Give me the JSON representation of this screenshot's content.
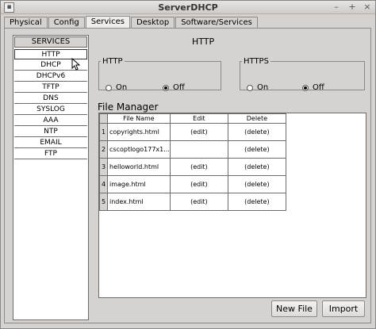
{
  "window": {
    "title": "ServerDHCP",
    "minimize_glyph": "–",
    "maximize_glyph": "+",
    "close_glyph": "×"
  },
  "tabs": [
    "Physical",
    "Config",
    "Services",
    "Desktop",
    "Software/Services"
  ],
  "active_tab": "Services",
  "sidebar": {
    "header": "SERVICES",
    "items": [
      "HTTP",
      "DHCP",
      "DHCPv6",
      "TFTP",
      "DNS",
      "SYSLOG",
      "AAA",
      "NTP",
      "EMAIL",
      "FTP"
    ],
    "selected": "HTTP"
  },
  "main": {
    "title": "HTTP",
    "http_group": {
      "legend": "HTTP",
      "on_label": "On",
      "off_label": "Off",
      "value": "Off"
    },
    "https_group": {
      "legend": "HTTPS",
      "on_label": "On",
      "off_label": "Off",
      "value": "Off"
    },
    "file_manager": {
      "label": "File Manager",
      "columns": [
        "File Name",
        "Edit",
        "Delete"
      ],
      "rows": [
        {
          "num": "1",
          "file": "copyrights.html",
          "edit": "(edit)",
          "delete": "(delete)"
        },
        {
          "num": "2",
          "file": "cscoptlogo177x1...",
          "edit": "",
          "delete": "(delete)"
        },
        {
          "num": "3",
          "file": "helloworld.html",
          "edit": "(edit)",
          "delete": "(delete)"
        },
        {
          "num": "4",
          "file": "image.html",
          "edit": "(edit)",
          "delete": "(delete)"
        },
        {
          "num": "5",
          "file": "index.html",
          "edit": "(edit)",
          "delete": "(delete)"
        }
      ]
    },
    "buttons": {
      "new_file": "New File",
      "import": "Import"
    }
  }
}
